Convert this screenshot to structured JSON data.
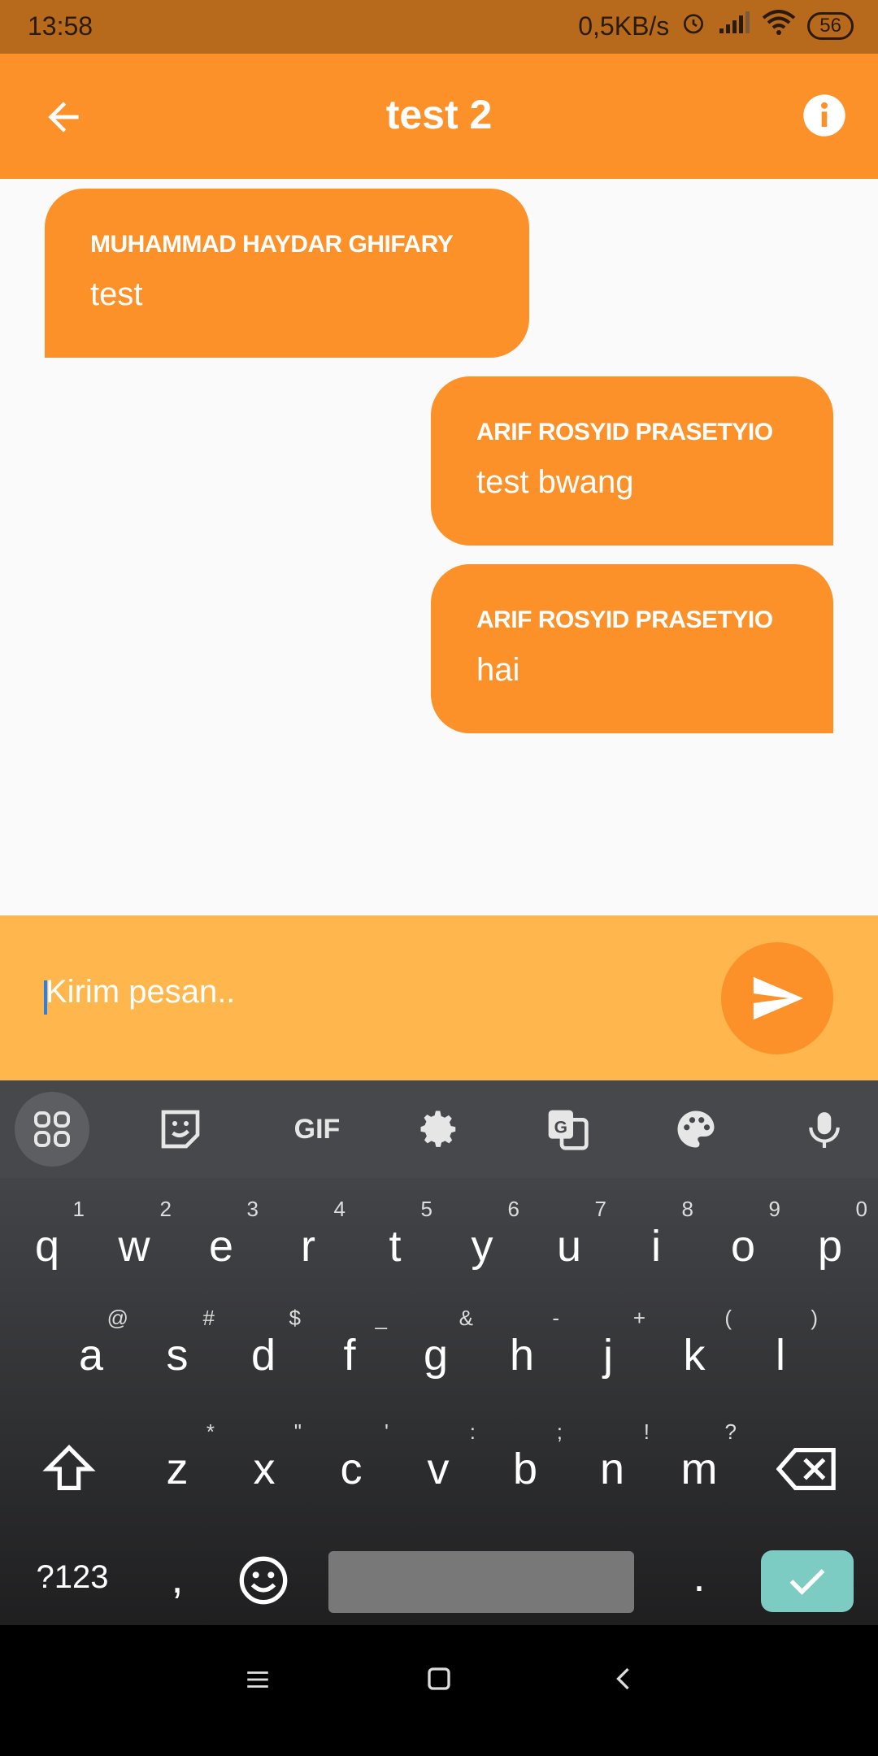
{
  "status": {
    "time": "13:58",
    "speed": "0,5KB/s",
    "battery": "56"
  },
  "appbar": {
    "title": "test 2"
  },
  "messages": [
    {
      "sender": "MUHAMMAD HAYDAR GHIFARY",
      "text": "test",
      "side": "left"
    },
    {
      "sender": "ARIF ROSYID PRASETYIO",
      "text": "test bwang",
      "side": "right"
    },
    {
      "sender": "ARIF ROSYID PRASETYIO",
      "text": "hai",
      "side": "right"
    }
  ],
  "input": {
    "placeholder": "Kirim pesan.."
  },
  "keyboard": {
    "toolbar": {
      "gif": "GIF"
    },
    "row1": [
      {
        "k": "q",
        "s": "1"
      },
      {
        "k": "w",
        "s": "2"
      },
      {
        "k": "e",
        "s": "3"
      },
      {
        "k": "r",
        "s": "4"
      },
      {
        "k": "t",
        "s": "5"
      },
      {
        "k": "y",
        "s": "6"
      },
      {
        "k": "u",
        "s": "7"
      },
      {
        "k": "i",
        "s": "8"
      },
      {
        "k": "o",
        "s": "9"
      },
      {
        "k": "p",
        "s": "0"
      }
    ],
    "row2": [
      {
        "k": "a",
        "s": "@"
      },
      {
        "k": "s",
        "s": "#"
      },
      {
        "k": "d",
        "s": "$"
      },
      {
        "k": "f",
        "s": "_"
      },
      {
        "k": "g",
        "s": "&"
      },
      {
        "k": "h",
        "s": "-"
      },
      {
        "k": "j",
        "s": "+"
      },
      {
        "k": "k",
        "s": "("
      },
      {
        "k": "l",
        "s": ")"
      }
    ],
    "row3": [
      {
        "k": "z",
        "s": "*"
      },
      {
        "k": "x",
        "s": "\""
      },
      {
        "k": "c",
        "s": "'"
      },
      {
        "k": "v",
        "s": ":"
      },
      {
        "k": "b",
        "s": ";"
      },
      {
        "k": "n",
        "s": "!"
      },
      {
        "k": "m",
        "s": "?"
      }
    ],
    "symbols_label": "?123",
    "comma": ",",
    "period": "."
  },
  "colors": {
    "primary": "#fb9128",
    "input_bg": "#ffb74d",
    "status_bg": "#b86a1c",
    "enter": "#7cccc3"
  }
}
